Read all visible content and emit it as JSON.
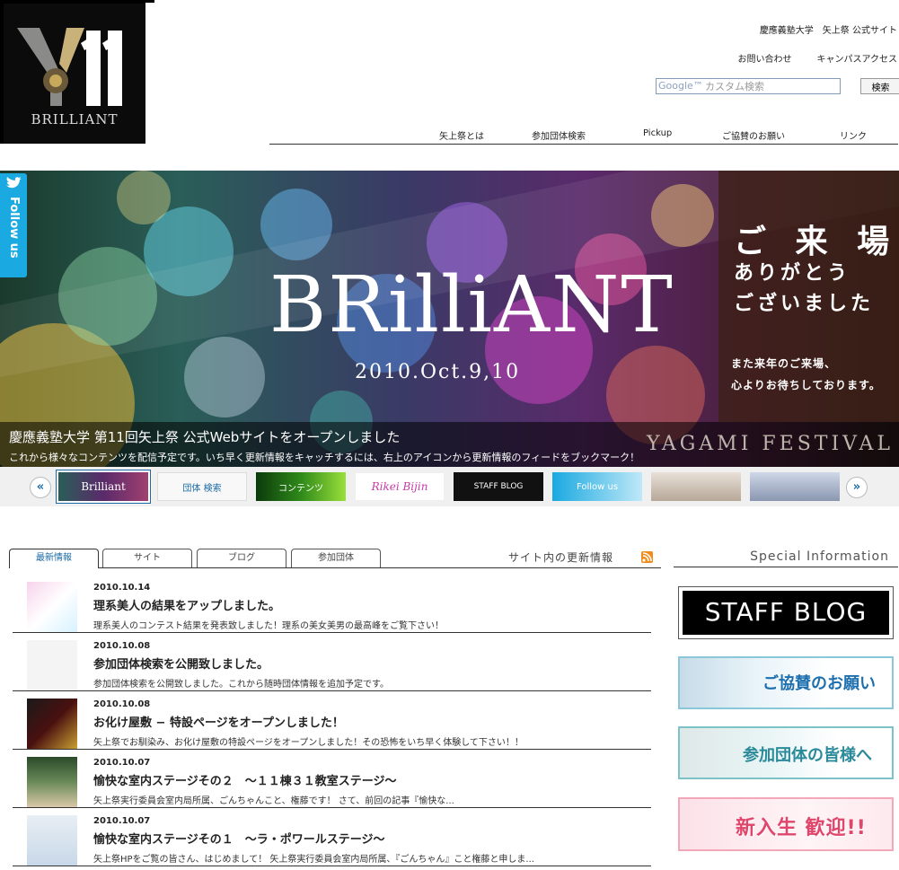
{
  "logo": {
    "mark": "Y11",
    "subtitle": "BRILLIANT"
  },
  "header": {
    "site_name": "慶應義塾大学　矢上祭 公式サイト",
    "util_links": [
      "お問い合わせ",
      "キャンパスアクセス"
    ],
    "search": {
      "placeholder": "カスタム検索",
      "brand": "Google™",
      "button": "検索"
    }
  },
  "nav": [
    "矢上祭とは",
    "参加団体検索",
    "Pickup",
    "ご協賛のお願い",
    "リンク"
  ],
  "follow": {
    "label": "Follow us"
  },
  "hero": {
    "title": "BRilliANT",
    "date": "2010.Oct.9,10",
    "thanks": [
      "ご 来 場",
      "ありがとう",
      "ございました"
    ],
    "next": [
      "また来年のご来場、",
      "心よりお待ちしております。"
    ],
    "caption_title": "慶應義塾大学 第11回矢上祭 公式Webサイトをオープンしました",
    "caption_text": "これから様々なコンテンツを配信予定です。いち早く更新情報をキャッチするには、右上のアイコンから更新情報のフィードをブックマーク！",
    "watermark": "YAGAMI FESTIVAL"
  },
  "thumbs": [
    "Brilliant",
    "団体 検索",
    "コンテンツ",
    "Rikei Bijin",
    "STAFF BLOG",
    "Follow us",
    "",
    "",
    ""
  ],
  "tabs": [
    "最新情報",
    "サイト",
    "ブログ",
    "参加団体"
  ],
  "updates_label": "サイト内の更新情報",
  "news": [
    {
      "date": "2010.10.14",
      "title": "理系美人の結果をアップしました。",
      "desc": "理系美人のコンテスト結果を発表致しました！理系の美女美男の最高峰をご覧下さい！"
    },
    {
      "date": "2010.10.08",
      "title": "参加団体検索を公開致しました。",
      "desc": "参加団体検索を公開致しました。これから随時団体情報を追加予定です。"
    },
    {
      "date": "2010.10.08",
      "title": "お化け屋敷 − 特設ページをオープンしました！",
      "desc": "矢上祭でお馴染み、お化け屋敷の特設ページをオープンしました！その恐怖をいち早く体験して下さい！！"
    },
    {
      "date": "2010.10.07",
      "title": "愉快な室内ステージその２　～１１棟３１教室ステージ～",
      "desc": "矢上祭実行委員会室内局所属、ごんちゃんこと、権藤です！ さて、前回の記事『愉快な..."
    },
    {
      "date": "2010.10.07",
      "title": "愉快な室内ステージその１　～ラ・ポワールステージ～",
      "desc": "矢上祭HPをご覧の皆さん、はじめまして！ 矢上祭実行委員会室内局所属、『ごんちゃん』こと権藤と申しま..."
    }
  ],
  "special": {
    "heading": "Special Information",
    "banners": [
      "STAFF BLOG",
      "ご協賛のお願い",
      "参加団体の皆様へ",
      "新入生 歓迎!!"
    ]
  },
  "colors": {
    "accent": "#1a6aa5",
    "twitter": "#1aa9e0",
    "rss": "#f28b19"
  }
}
